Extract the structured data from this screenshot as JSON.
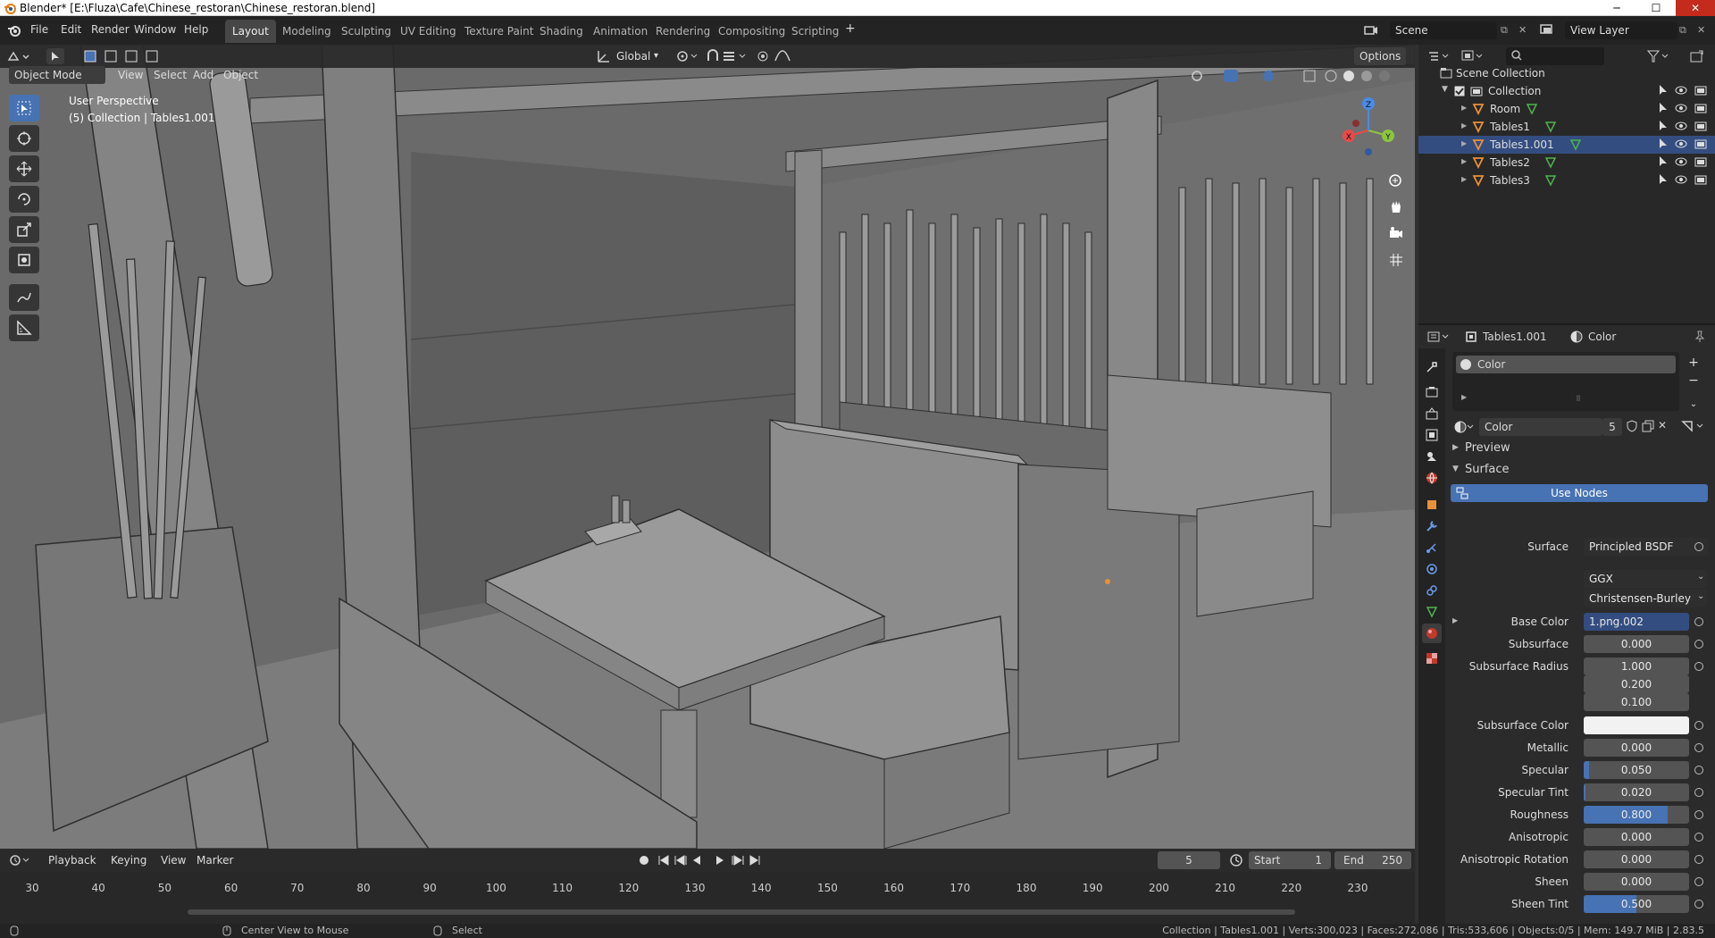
{
  "window": {
    "title": "Blender* [E:\\Fluza\\Cafe\\Chinese_restoran\\Chinese_restoran.blend]"
  },
  "menu": [
    "File",
    "Edit",
    "Render",
    "Window",
    "Help"
  ],
  "workspaces": [
    "Layout",
    "Modeling",
    "Sculpting",
    "UV Editing",
    "Texture Paint",
    "Shading",
    "Animation",
    "Rendering",
    "Compositing",
    "Scripting"
  ],
  "active_workspace": "Layout",
  "scene": {
    "name": "Scene",
    "view_layer": "View Layer"
  },
  "viewport": {
    "mode": "Object Mode",
    "menus": [
      "View",
      "Select",
      "Add",
      "Object"
    ],
    "transform_orientation": "Global",
    "options_label": "Options",
    "perspective_text": "User Perspective",
    "collection_text": "(5) Collection | Tables1.001",
    "gizmo_axes": {
      "x": "X",
      "y": "Y",
      "z": "Z"
    }
  },
  "outliner": {
    "root": "Scene Collection",
    "collection": "Collection",
    "objects": [
      "Room",
      "Tables1",
      "Tables1.001",
      "Tables2",
      "Tables3"
    ],
    "selected": "Tables1.001"
  },
  "properties": {
    "breadcrumb_object": "Tables1.001",
    "breadcrumb_material": "Color",
    "slot_name": "Color",
    "material_name": "Color",
    "user_count": "5",
    "panels": {
      "preview": "Preview",
      "surface": "Surface"
    },
    "use_nodes_label": "Use Nodes",
    "surface_label": "Surface",
    "surface_value": "Principled BSDF",
    "distribution": "GGX",
    "subsurface_method": "Christensen-Burley",
    "rows": [
      {
        "label": "Base Color",
        "value": "1.png.002",
        "kind": "link"
      },
      {
        "label": "Subsurface",
        "value": "0.000",
        "fill": 0
      },
      {
        "label": "Subsurface Radius",
        "value": "1.000",
        "fill": 0
      },
      {
        "label": "",
        "value": "0.200",
        "fill": 0
      },
      {
        "label": "",
        "value": "0.100",
        "fill": 0
      },
      {
        "label": "Subsurface Color",
        "value": "",
        "kind": "color"
      },
      {
        "label": "Metallic",
        "value": "0.000",
        "fill": 0
      },
      {
        "label": "Specular",
        "value": "0.050",
        "fill": 0.05
      },
      {
        "label": "Specular Tint",
        "value": "0.020",
        "fill": 0.02
      },
      {
        "label": "Roughness",
        "value": "0.800",
        "fill": 0.8
      },
      {
        "label": "Anisotropic",
        "value": "0.000",
        "fill": 0
      },
      {
        "label": "Anisotropic Rotation",
        "value": "0.000",
        "fill": 0
      },
      {
        "label": "Sheen",
        "value": "0.000",
        "fill": 0
      },
      {
        "label": "Sheen Tint",
        "value": "0.500",
        "fill": 0.5
      }
    ]
  },
  "timeline": {
    "menus": [
      "Playback",
      "Keying",
      "View",
      "Marker"
    ],
    "current_frame": "5",
    "start_label": "Start",
    "start": "1",
    "end_label": "End",
    "end": "250",
    "ticks": [
      "30",
      "40",
      "50",
      "60",
      "70",
      "80",
      "90",
      "100",
      "110",
      "120",
      "130",
      "140",
      "150",
      "160",
      "170",
      "180",
      "190",
      "200",
      "210",
      "220",
      "230"
    ]
  },
  "statusbar": {
    "hint1": "Center View to Mouse",
    "hint2": "Select",
    "stats": "Collection | Tables1.001 | Verts:300,023 | Faces:272,086 | Tris:533,606 | Objects:0/5 | Mem: 149.7 MiB | 2.83.5"
  },
  "colors": {
    "accent": "#4772b3",
    "selected_row": "#334d80",
    "viewport_bg": "#6a6a6a",
    "object_orange": "#e8903a",
    "mesh_green": "#4fb34f"
  }
}
